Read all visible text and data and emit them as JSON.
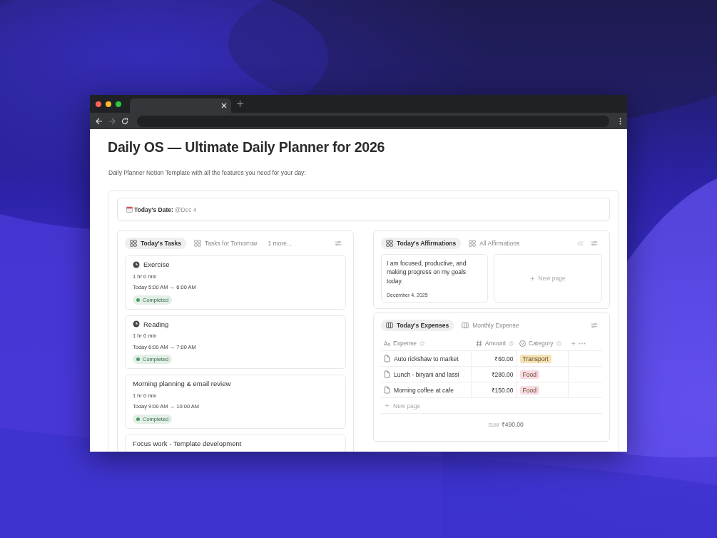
{
  "page": {
    "title": "Daily OS — Ultimate Daily Planner for 2026",
    "subtitle": "Daily Planner Notion Template with all the features you need for your day:"
  },
  "date_callout": {
    "label": "Today's Date:",
    "value": "@Dec 4"
  },
  "tasks": {
    "tabs": [
      {
        "label": "Today's Tasks",
        "selected": true
      },
      {
        "label": "Tasks for Tomorrow",
        "selected": false
      }
    ],
    "more": "1 more...",
    "cards": [
      {
        "title": "Exercise",
        "has_icon": true,
        "duration": "1 hr 0 min",
        "time": "Today 5:00 AM → 6:00 AM",
        "status": "Completed"
      },
      {
        "title": "Reading",
        "has_icon": true,
        "duration": "1 hr 0 min",
        "time": "Today 6:00 AM → 7:00 AM",
        "status": "Completed"
      },
      {
        "title": "Morning planning & email review",
        "has_icon": false,
        "duration": "1 hr 0 min",
        "time": "Today 9:00 AM → 10:00 AM",
        "status": "Completed"
      },
      {
        "title": "Focus work - Template development",
        "has_icon": false
      }
    ]
  },
  "affirmations": {
    "tabs": [
      {
        "label": "Today's Affirmations",
        "selected": true
      },
      {
        "label": "All Affirmations",
        "selected": false
      }
    ],
    "cards": [
      {
        "text": "I am focused, productive, and making progress on my goals today.",
        "date": "December 4, 2025"
      }
    ],
    "new_page": "New page"
  },
  "expenses": {
    "tabs": [
      {
        "label": "Today's Expenses",
        "selected": true
      },
      {
        "label": "Monthly Expense",
        "selected": false
      }
    ],
    "columns": [
      "Expense",
      "Amount",
      "Category"
    ],
    "rows": [
      {
        "expense": "Auto rickshaw to market",
        "amount": "₹60.00",
        "category": "Transport",
        "color": "#f3e3b5"
      },
      {
        "expense": "Lunch - biryani and lassi",
        "amount": "₹280.00",
        "category": "Food",
        "color": "#f7dbe2"
      },
      {
        "expense": "Morning coffee at cafe",
        "amount": "₹150.00",
        "category": "Food",
        "color": "#f7dbe2"
      }
    ],
    "new_page": "New page",
    "sum_label": "SUM",
    "sum": "₹490.00"
  }
}
